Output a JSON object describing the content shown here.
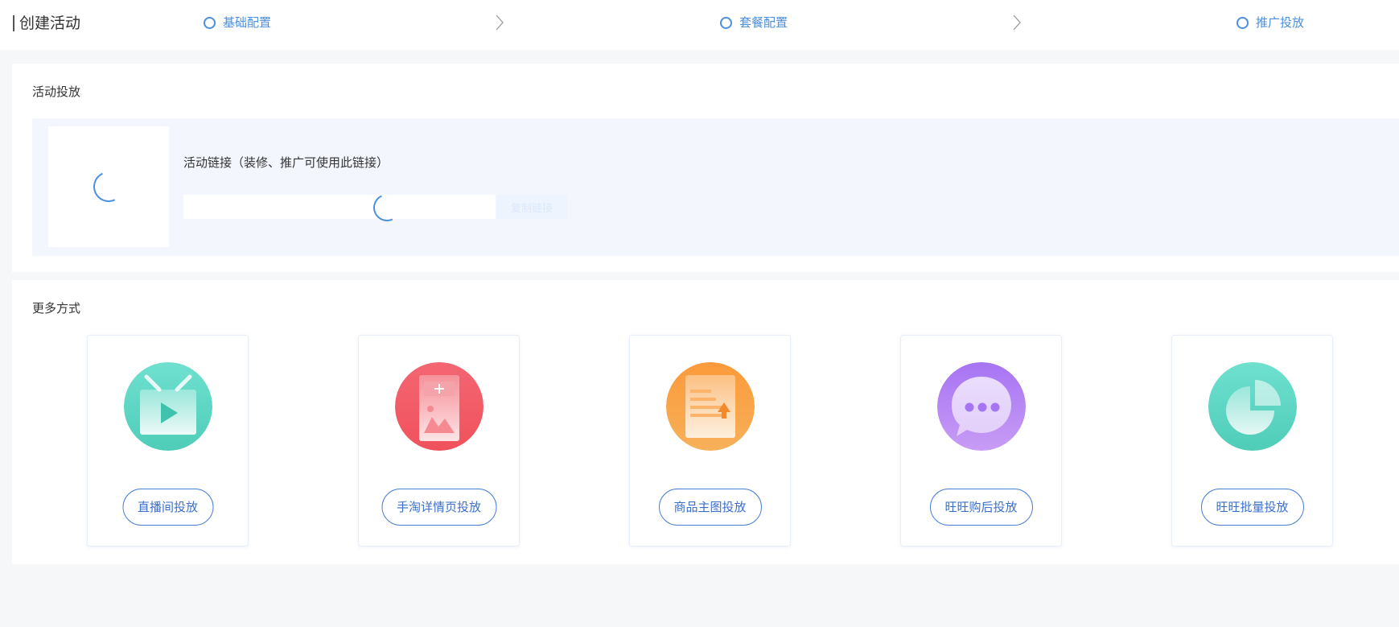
{
  "header": {
    "title": "创建活动",
    "steps": [
      {
        "label": "基础配置"
      },
      {
        "label": "套餐配置"
      },
      {
        "label": "推广投放"
      }
    ]
  },
  "campaign": {
    "section_title": "活动投放",
    "link_label": "活动链接（装修、推广可使用此链接）",
    "link_value": "",
    "copy_label": "复制链接"
  },
  "more": {
    "section_title": "更多方式",
    "methods": [
      {
        "label": "直播间投放",
        "icon": "tv-play-icon",
        "color": "#5fd6c4"
      },
      {
        "label": "手淘详情页投放",
        "icon": "detail-page-icon",
        "color": "#f0606a"
      },
      {
        "label": "商品主图投放",
        "icon": "main-image-upload-icon",
        "color": "#f99a3a"
      },
      {
        "label": "旺旺购后投放",
        "icon": "chat-bubble-icon",
        "color": "#a97ef2"
      },
      {
        "label": "旺旺批量投放",
        "icon": "pie-chart-icon",
        "color": "#5fd6c4"
      }
    ]
  },
  "colors": {
    "accent": "#4a8fe0",
    "button_border": "#4a7ed4",
    "panel_bg": "#f3f7fd"
  }
}
